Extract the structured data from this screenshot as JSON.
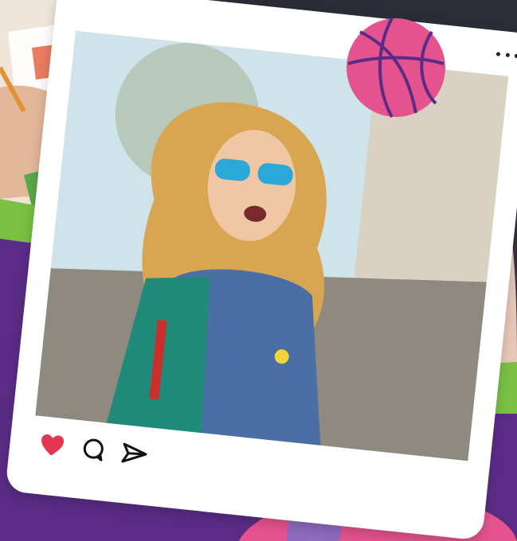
{
  "colors": {
    "purple": "#5b2c86",
    "green": "#79c043",
    "pink": "#e5538e",
    "lavender": "#8e6bbd",
    "frame": "#ffffff",
    "heart": "#e2374e",
    "sky": "#cfe3ea",
    "wall": "#d9d1c2"
  },
  "post": {
    "menu_icon": "more-dots-icon",
    "actions": [
      {
        "name": "like",
        "icon": "heart-icon"
      },
      {
        "name": "comment",
        "icon": "comment-bubble-icon"
      },
      {
        "name": "share",
        "icon": "send-icon"
      }
    ]
  },
  "decorations": {
    "ball_icon": "basketball-icon"
  }
}
